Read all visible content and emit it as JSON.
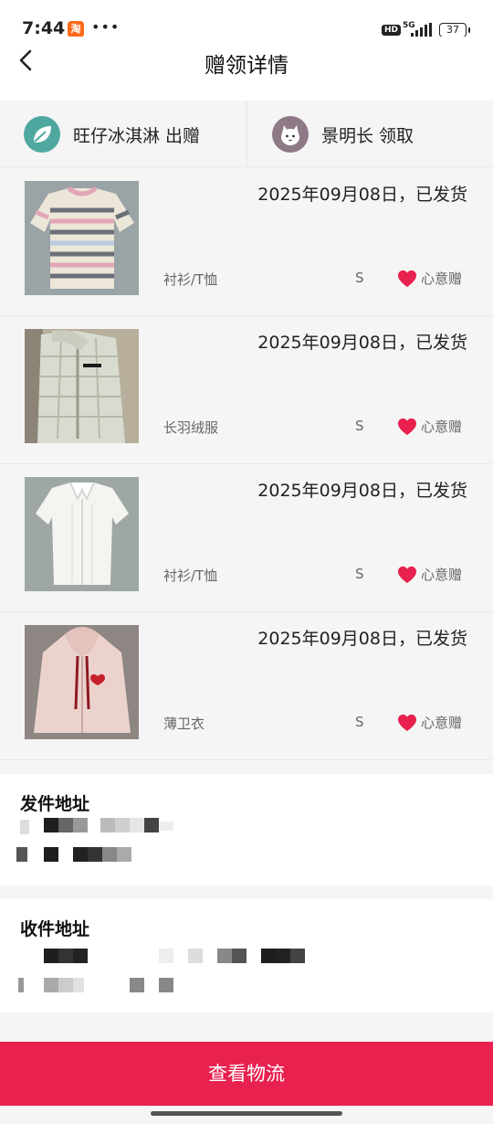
{
  "status_bar": {
    "time": "7:44",
    "app_badge": "淘",
    "more": "•••",
    "hd": "HD",
    "network": "5G",
    "battery": "37"
  },
  "header": {
    "title": "赠领详情"
  },
  "parties": {
    "giver": {
      "name": "旺仔冰淇淋 出赠",
      "avatar_icon": "leaf-avatar-icon",
      "avatar_color": "#4fa8a0"
    },
    "receiver": {
      "name": "景明长 领取",
      "avatar_icon": "cat-avatar-icon",
      "avatar_color": "#8e7a86"
    }
  },
  "items": [
    {
      "date_status": "2025年09月08日，已发货",
      "category": "衬衫/T恤",
      "size": "S",
      "tag": "心意赠",
      "photo": "striped-shirt-photo"
    },
    {
      "date_status": "2025年09月08日，已发货",
      "category": "长羽绒服",
      "size": "S",
      "tag": "心意赠",
      "photo": "down-coat-photo"
    },
    {
      "date_status": "2025年09月08日，已发货",
      "category": "衬衫/T恤",
      "size": "S",
      "tag": "心意赠",
      "photo": "white-blouse-photo"
    },
    {
      "date_status": "2025年09月08日，已发货",
      "category": "薄卫衣",
      "size": "S",
      "tag": "心意赠",
      "photo": "pink-hoodie-photo"
    }
  ],
  "sender_address": {
    "label": "发件地址"
  },
  "receiver_address": {
    "label": "收件地址"
  },
  "bottom_button": {
    "label": "查看物流"
  },
  "colors": {
    "accent": "#e8214f",
    "heart": "#e8214f"
  }
}
